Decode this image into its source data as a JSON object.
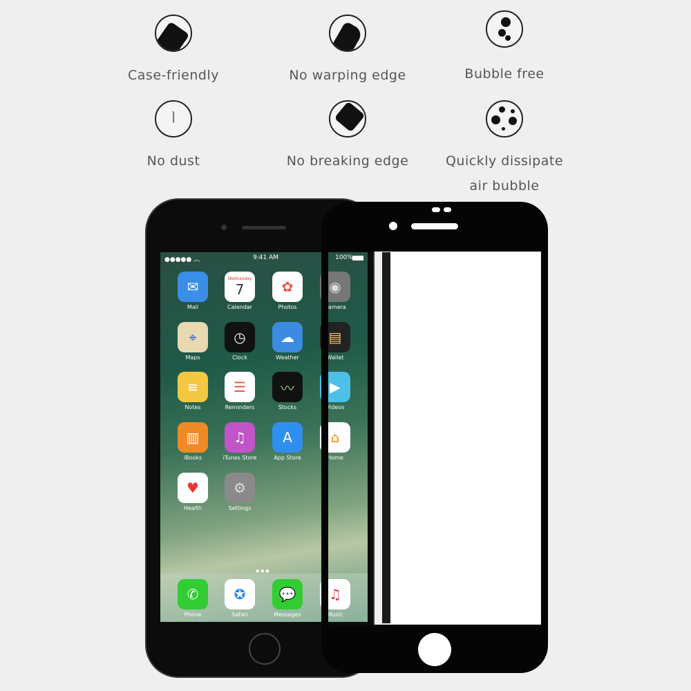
{
  "features": [
    {
      "label": "Case-friendly",
      "icon": "case-friendly-icon"
    },
    {
      "label": "No warping edge",
      "icon": "no-warping-edge-icon"
    },
    {
      "label": "Bubble free",
      "icon": "bubble-free-icon"
    },
    {
      "label": "No dust",
      "icon": "no-dust-icon"
    },
    {
      "label": "No breaking edge",
      "icon": "no-breaking-edge-icon"
    },
    {
      "label": "Quickly dissipate",
      "label2": "air bubble",
      "icon": "dissipate-bubble-icon"
    }
  ],
  "phone": {
    "time": "9:41 AM",
    "battery": "100%",
    "calendar_day": "Wednesday",
    "calendar_date": "7",
    "apps": [
      "Mail",
      "Calendar",
      "Photos",
      "Camera",
      "Maps",
      "Clock",
      "Weather",
      "Wallet",
      "Notes",
      "Reminders",
      "Stocks",
      "Videos",
      "iBooks",
      "iTunes Store",
      "App Store",
      "Home",
      "Health",
      "Settings"
    ],
    "dock": [
      "Phone",
      "Safari",
      "Messages",
      "Music"
    ]
  }
}
